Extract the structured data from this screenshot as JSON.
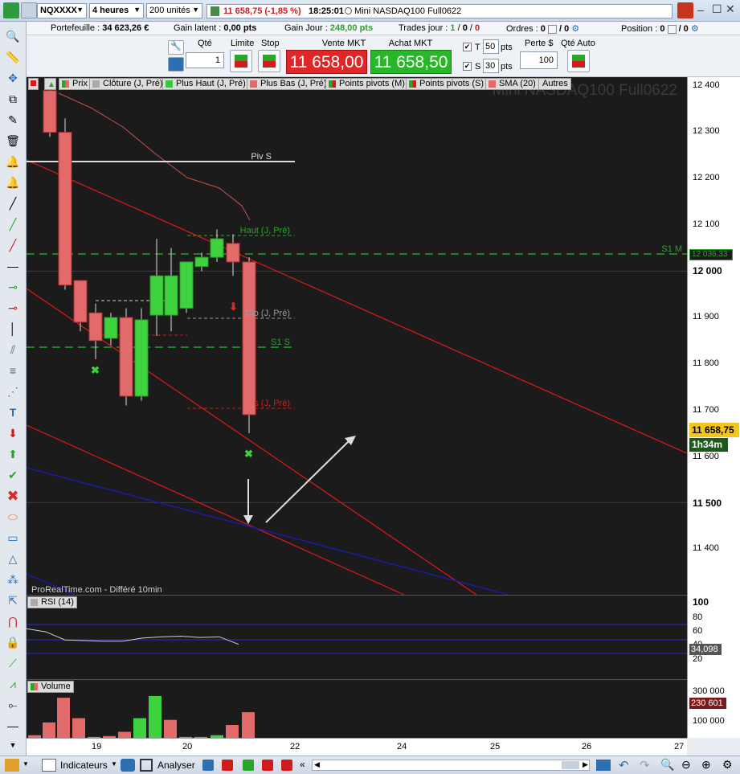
{
  "titlebar": {
    "symbol": "NQXXXX",
    "timeframe": "4 heures",
    "units": "200 unités",
    "price_change": "11 658,75 (-1,85 %)",
    "time": "18:25:01",
    "instrument": "Mini NASDAQ100 Full0622"
  },
  "info": {
    "portefeuille_label": "Portefeuille :",
    "portefeuille_value": "34 623,26 €",
    "gain_latent_label": "Gain latent :",
    "gain_latent_value": "0,00 pts",
    "gain_jour_label": "Gain Jour :",
    "gain_jour_value": "248,00 pts",
    "trades_label": "Trades jour :",
    "trades_a": "1",
    "trades_b": "0",
    "trades_c": "0",
    "ordres_label": "Ordres :",
    "ordres_value": "0",
    "ordres_total": "/ 0",
    "position_label": "Position :",
    "position_value": "0",
    "position_total": "/ 0"
  },
  "order": {
    "qte_label": "Qté",
    "qte_value": "1",
    "limite_label": "Limite",
    "stop_label": "Stop",
    "vente_label": "Vente MKT",
    "vente_price": "11 658,00",
    "achat_label": "Achat MKT",
    "achat_price": "11 658,50",
    "t_label": "T",
    "t_value": "50",
    "s_label": "S",
    "s_value": "30",
    "pts": "pts",
    "perte_label": "Perte $",
    "perte_value": "100",
    "qte_auto_label": "Qté Auto"
  },
  "legend": [
    "Prix",
    "Clôture (J, Pré)",
    "Plus Haut (J, Pré)",
    "Plus Bas (J, Pré)",
    "Points pivots (M)",
    "Points pivots (S)",
    "SMA (20)",
    "Autres"
  ],
  "chart": {
    "watermark": "Mini NASDAQ100 Full0622",
    "source": "ProRealTime.com - Différé 10min",
    "labels": {
      "piv_s": "Piv S",
      "haut": "Haut (J, Pré)",
      "clo": "Clo (J, Pré)",
      "s1s": "S1 S",
      "bas": "s (J, Pré)",
      "s1m": "S1 M"
    }
  },
  "rsi": {
    "label": "RSI (14)",
    "value": "34,098"
  },
  "volume": {
    "label": "Volume",
    "value": "230 601"
  },
  "axis": {
    "price_ticks": [
      "12 400",
      "12 300",
      "12 200",
      "12 100",
      "12 000",
      "11 900",
      "11 800",
      "11 700",
      "11 600",
      "11 500",
      "11 400"
    ],
    "s1m_price": "12 036,33",
    "last_price": "11 658,75",
    "countdown": "1h34m",
    "rsi_ticks": [
      "100",
      "80",
      "60",
      "40",
      "20"
    ],
    "vol_ticks": [
      "300 000",
      "200 000",
      "100 000"
    ],
    "x_ticks": [
      "19",
      "20",
      "22",
      "24",
      "25",
      "26",
      "27"
    ]
  },
  "bottom": {
    "indicateurs": "Indicateurs",
    "analyser": "Analyser"
  },
  "chart_data": {
    "type": "candlestick",
    "title": "Mini NASDAQ100 Full0622",
    "candles": [
      {
        "o": 12390,
        "h": 12410,
        "c": 12300,
        "l": 12290,
        "dir": "down"
      },
      {
        "o": 12300,
        "h": 12330,
        "c": 11970,
        "l": 11960,
        "dir": "down"
      },
      {
        "o": 11980,
        "h": 11980,
        "c": 11890,
        "l": 11870,
        "dir": "down"
      },
      {
        "o": 11910,
        "h": 11930,
        "c": 11850,
        "l": 11810,
        "dir": "down"
      },
      {
        "o": 11855,
        "h": 11910,
        "c": 11900,
        "l": 11840,
        "dir": "up"
      },
      {
        "o": 11900,
        "h": 11920,
        "c": 11730,
        "l": 11710,
        "dir": "down"
      },
      {
        "o": 11730,
        "h": 11920,
        "c": 11895,
        "l": 11720,
        "dir": "up"
      },
      {
        "o": 11905,
        "h": 12070,
        "c": 11990,
        "l": 11860,
        "dir": "up"
      },
      {
        "o": 11905,
        "h": 12050,
        "c": 11990,
        "l": 11870,
        "dir": "up"
      },
      {
        "o": 11920,
        "h": 12020,
        "c": 12020,
        "l": 11910,
        "dir": "up"
      },
      {
        "o": 12010,
        "h": 12040,
        "c": 12030,
        "l": 12000,
        "dir": "up"
      },
      {
        "o": 12030,
        "h": 12090,
        "c": 12070,
        "l": 12020,
        "dir": "up"
      },
      {
        "o": 12060,
        "h": 12080,
        "c": 12020,
        "l": 11990,
        "dir": "down"
      },
      {
        "o": 12020,
        "h": 12030,
        "c": 11690,
        "l": 11650,
        "dir": "down"
      }
    ],
    "volume": [
      20000,
      95000,
      240000,
      120000,
      10000,
      15000,
      40000,
      120000,
      250000,
      110000,
      10000,
      10000,
      20000,
      80000,
      155000
    ],
    "rsi": [
      60,
      55,
      42,
      41,
      40,
      40,
      45,
      47,
      48,
      46,
      47,
      35
    ],
    "ylim": [
      11300,
      12450
    ]
  }
}
